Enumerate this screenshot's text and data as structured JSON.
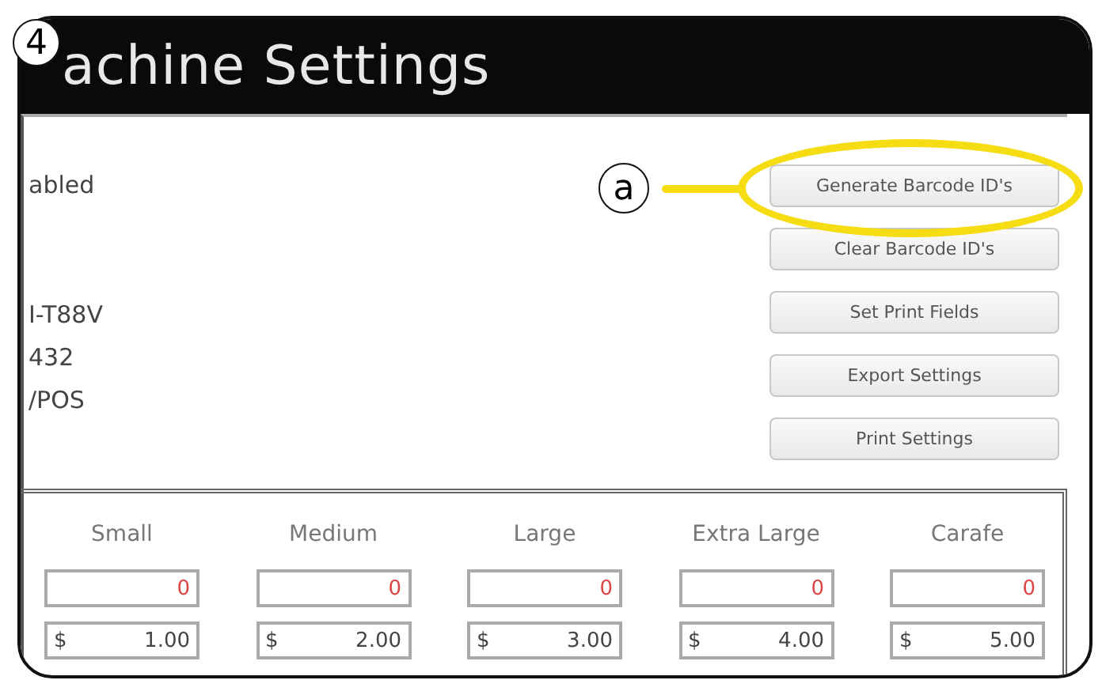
{
  "step_badge": "4",
  "window": {
    "title": "achine Settings"
  },
  "info_lines": [
    {
      "text": "abled"
    },
    {
      "text": "I-T88V"
    },
    {
      "text": "432"
    },
    {
      "text": "/POS"
    }
  ],
  "buttons": [
    {
      "label": "Generate Barcode ID's"
    },
    {
      "label": "Clear Barcode ID's"
    },
    {
      "label": "Set Print Fields"
    },
    {
      "label": "Export Settings"
    },
    {
      "label": "Print Settings"
    }
  ],
  "callout": {
    "label": "a"
  },
  "sizes": [
    {
      "name": "Small",
      "count": "0",
      "currency": "$",
      "price": "1.00"
    },
    {
      "name": "Medium",
      "count": "0",
      "currency": "$",
      "price": "2.00"
    },
    {
      "name": "Large",
      "count": "0",
      "currency": "$",
      "price": "3.00"
    },
    {
      "name": "Extra Large",
      "count": "0",
      "currency": "$",
      "price": "4.00"
    },
    {
      "name": "Carafe",
      "count": "0",
      "currency": "$",
      "price": "5.00"
    }
  ]
}
